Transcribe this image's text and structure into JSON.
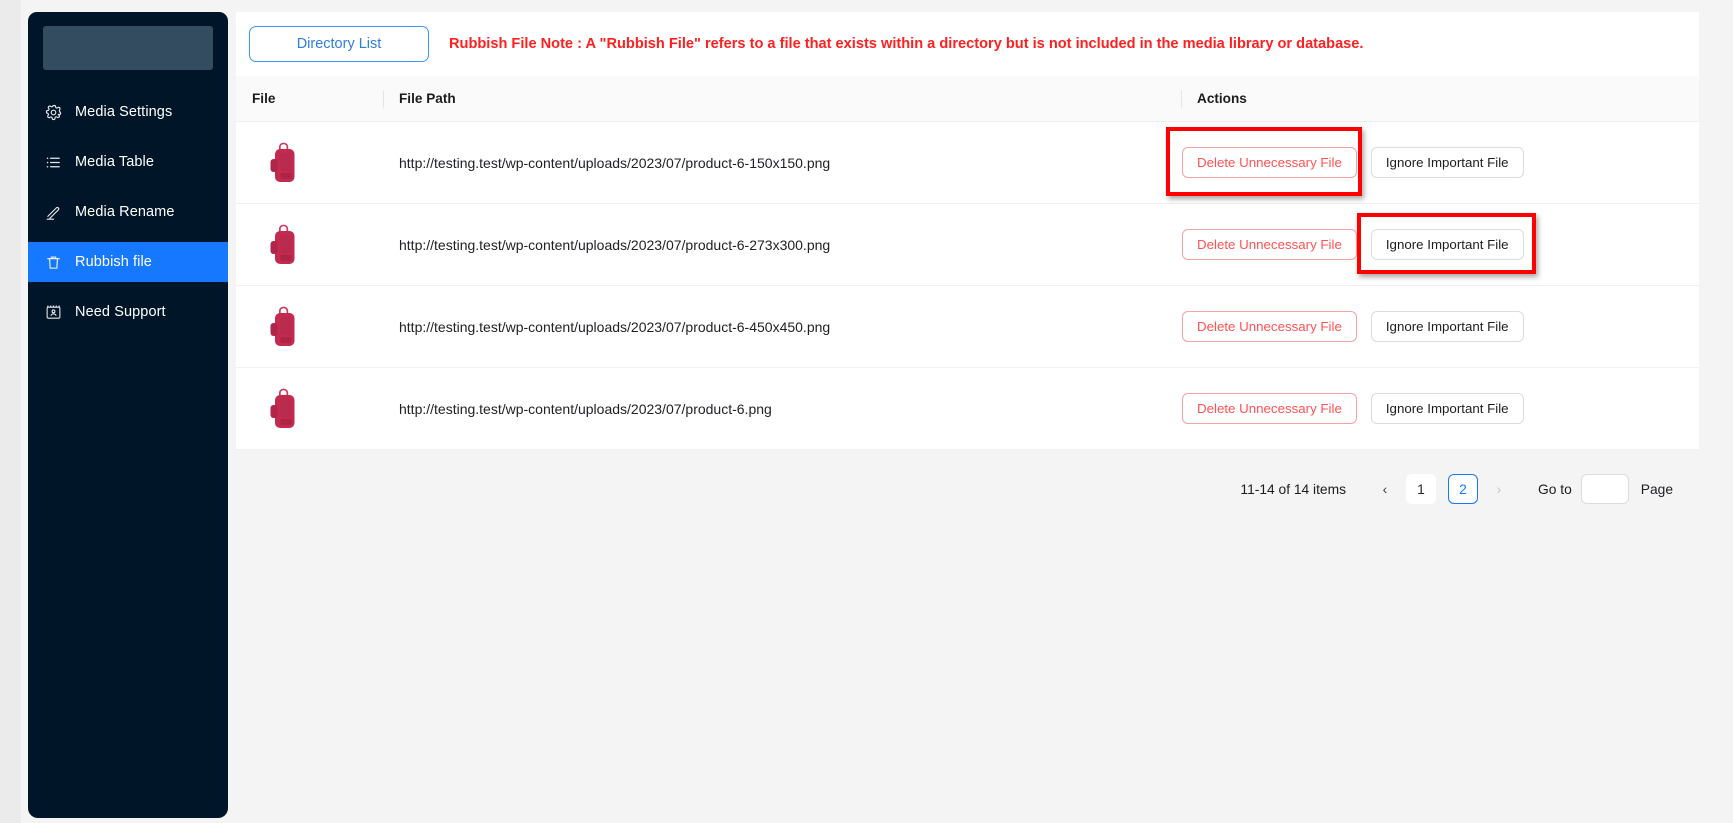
{
  "sidebar": {
    "brand_placeholder": "",
    "items": [
      {
        "label": "Media Settings",
        "icon": "gear-icon",
        "active": false
      },
      {
        "label": "Media Table",
        "icon": "list-icon",
        "active": false
      },
      {
        "label": "Media Rename",
        "icon": "pencil-icon",
        "active": false
      },
      {
        "label": "Rubbish file",
        "icon": "trash-icon",
        "active": true
      },
      {
        "label": "Need Support",
        "icon": "support-icon",
        "active": false
      }
    ]
  },
  "toolbar": {
    "directory_list_label": "Directory List",
    "note": "Rubbish File Note : A \"Rubbish File\" refers to a file that exists within a directory but is not included in the media library or database."
  },
  "table": {
    "headers": [
      "File",
      "File Path",
      "Actions"
    ],
    "rows": [
      {
        "thumb_alt": "product-6 backpack thumbnail",
        "path": "http://testing.test/wp-content/uploads/2023/07/product-6-150x150.png",
        "delete_label": "Delete Unnecessary File",
        "ignore_label": "Ignore Important File"
      },
      {
        "thumb_alt": "product-6 backpack thumbnail",
        "path": "http://testing.test/wp-content/uploads/2023/07/product-6-273x300.png",
        "delete_label": "Delete Unnecessary File",
        "ignore_label": "Ignore Important File"
      },
      {
        "thumb_alt": "product-6 backpack thumbnail",
        "path": "http://testing.test/wp-content/uploads/2023/07/product-6-450x450.png",
        "delete_label": "Delete Unnecessary File",
        "ignore_label": "Ignore Important File"
      },
      {
        "thumb_alt": "product-6 backpack thumbnail",
        "path": "http://testing.test/wp-content/uploads/2023/07/product-6.png",
        "delete_label": "Delete Unnecessary File",
        "ignore_label": "Ignore Important File"
      }
    ]
  },
  "pagination": {
    "total_text": "11-14 of 14 items",
    "prev_glyph": "‹",
    "next_glyph": "›",
    "pages": [
      "1",
      "2"
    ],
    "current_page": "2",
    "goto_label": "Go to",
    "goto_value": "",
    "page_suffix": "Page"
  },
  "colors": {
    "sidebar_bg": "#001628",
    "sidebar_active": "#1677ff",
    "note_red": "#ff1f1f",
    "delete_red": "#ff5252",
    "accent_blue": "#1677ff",
    "thumb_crimson": "#c4294f",
    "highlight_red": "#ff0000"
  }
}
